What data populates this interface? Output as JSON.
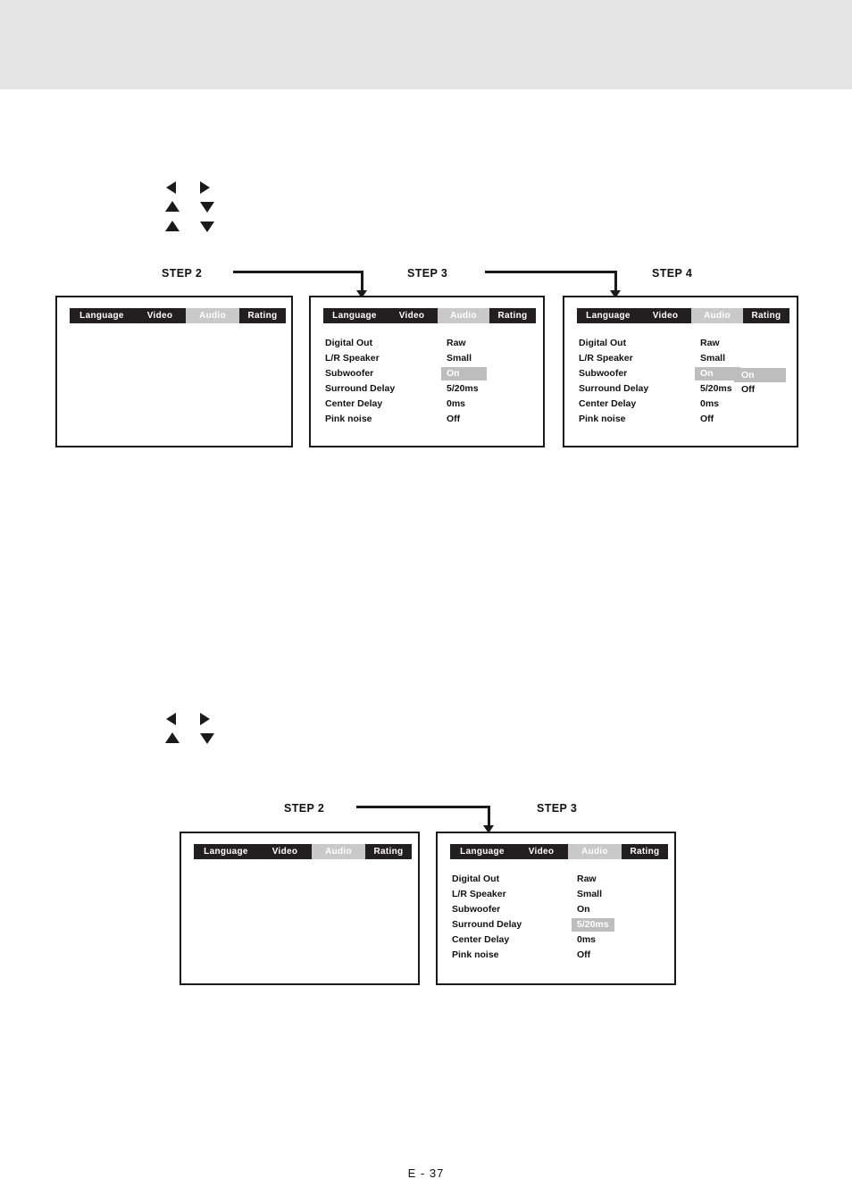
{
  "page": {
    "footer_label": "E - 37"
  },
  "osd_tabs": [
    "Language",
    "Video",
    "Audio",
    "Rating"
  ],
  "osd_selected_tab": "Audio",
  "audio_menu": {
    "rows": [
      {
        "label": "Digital Out",
        "value": "Raw"
      },
      {
        "label": "L/R Speaker",
        "value": "Small"
      },
      {
        "label": "Subwoofer",
        "value": "On"
      },
      {
        "label": "Surround Delay",
        "value": "5/20ms"
      },
      {
        "label": "Center Delay",
        "value": "0ms"
      },
      {
        "label": "Pink noise",
        "value": "Off"
      }
    ]
  },
  "section_top": {
    "steps": [
      {
        "name": "STEP 2"
      },
      {
        "name": "STEP 3"
      },
      {
        "name": "STEP 4"
      }
    ],
    "arrow_keys": [
      {
        "left": "left-arrow",
        "right": "right-arrow"
      },
      {
        "left": "up-arrow",
        "right": "down-arrow"
      },
      {
        "left": "up-arrow",
        "right": "down-arrow"
      }
    ],
    "screen_step2": {
      "highlighted_value_row": null
    },
    "screen_step3": {
      "highlighted_value_row": "Subwoofer",
      "highlighted_value": "On"
    },
    "screen_step4": {
      "highlighted_value_row": "Subwoofer",
      "highlighted_value": "On",
      "popup_options": [
        {
          "text": "On",
          "selected": true
        },
        {
          "text": "Off",
          "selected": false
        }
      ]
    }
  },
  "section_bottom": {
    "steps": [
      {
        "name": "STEP 2"
      },
      {
        "name": "STEP 3"
      }
    ],
    "arrow_keys": [
      {
        "left": "left-arrow",
        "right": "right-arrow"
      },
      {
        "left": "up-arrow",
        "right": "down-arrow"
      }
    ],
    "screen_step2": {
      "highlighted_value_row": null
    },
    "screen_step3": {
      "highlighted_value_row": "Surround Delay",
      "highlighted_value": "5/20ms"
    }
  },
  "colors": {
    "header_band": "#e4e4e4",
    "tabbar_bg": "#231f20",
    "tab_selected_bg": "#c9c9c9",
    "highlight_bg": "#bdbdbd",
    "ink": "#1a1a1a"
  }
}
